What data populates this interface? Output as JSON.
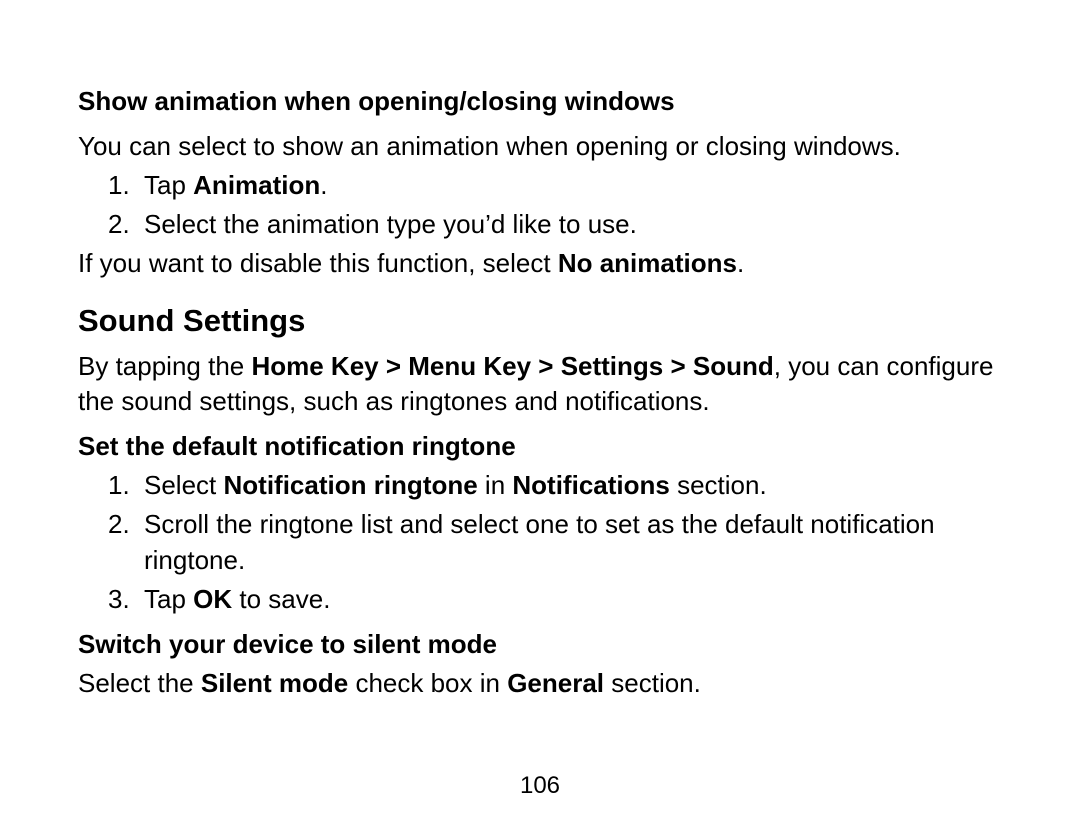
{
  "section1": {
    "heading": "Show animation when opening/closing windows",
    "intro": "You can select to show an animation when opening or closing windows.",
    "steps": [
      {
        "num": "1.",
        "prefix": "Tap ",
        "bold1": "Animation",
        "suffix": "."
      },
      {
        "num": "2.",
        "text": "Select the animation type you’d like to use."
      }
    ],
    "after_prefix": "If you want to disable this function, select ",
    "after_bold": "No animations",
    "after_suffix": "."
  },
  "section2": {
    "heading": "Sound Settings",
    "intro_prefix": "By tapping the ",
    "intro_bold": "Home Key > Menu Key > Settings > Sound",
    "intro_suffix": ", you can configure the sound settings, such as ringtones and notifications."
  },
  "section3": {
    "heading": "Set the default notification ringtone",
    "steps": [
      {
        "num": "1.",
        "prefix": "Select ",
        "bold1": "Notification ringtone",
        "mid": " in ",
        "bold2": "Notifications",
        "suffix": " section."
      },
      {
        "num": "2.",
        "text": "Scroll the ringtone list and select one to set as the default notification ringtone."
      },
      {
        "num": "3.",
        "prefix": "Tap ",
        "bold1": "OK",
        "suffix": " to save."
      }
    ]
  },
  "section4": {
    "heading": "Switch your device to silent mode",
    "line_prefix": "Select the ",
    "line_bold1": "Silent mode",
    "line_mid": " check box in ",
    "line_bold2": "General",
    "line_suffix": " section."
  },
  "page_number": "106"
}
